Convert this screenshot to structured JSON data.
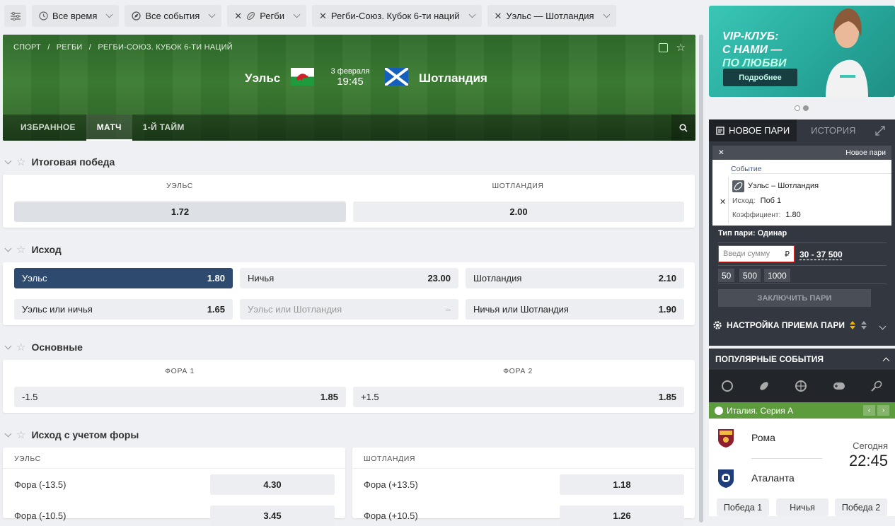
{
  "filters": {
    "time": "Все время",
    "events": "Все события",
    "sport": "Регби",
    "tournament": "Регби-Союз. Кубок 6-ти наций",
    "match": "Уэльс — Шотландия"
  },
  "hero": {
    "breadcrumbs": [
      "СПОРТ",
      "/",
      "РЕГБИ",
      "/",
      "РЕГБИ-СОЮЗ. КУБОК 6-ТИ НАЦИЙ"
    ],
    "home": "Уэльс",
    "away": "Шотландия",
    "date": "3 февраля",
    "time": "19:45",
    "tabs": [
      "ИЗБРАННОЕ",
      "МАТЧ",
      "1-Й ТАЙМ"
    ]
  },
  "markets": {
    "win": {
      "title": "Итоговая победа",
      "col1": "УЭЛЬС",
      "col2": "ШОТЛАНДИЯ",
      "odd1": "1.72",
      "odd2": "2.00"
    },
    "outcome": {
      "title": "Исход",
      "cells": [
        {
          "label": "Уэльс",
          "value": "1.80"
        },
        {
          "label": "Ничья",
          "value": "23.00"
        },
        {
          "label": "Шотландия",
          "value": "2.10"
        },
        {
          "label": "Уэльс или ничья",
          "value": "1.65"
        },
        {
          "label": "Уэльс или Шотландия",
          "value": "–"
        },
        {
          "label": "Ничья или Шотландия",
          "value": "1.90"
        }
      ]
    },
    "main": {
      "title": "Основные",
      "col1": "ФОРА 1",
      "col2": "ФОРА 2",
      "h1": "-1.5",
      "v1": "1.85",
      "h2": "+1.5",
      "v2": "1.85"
    },
    "handicap": {
      "title": "Исход с учетом форы",
      "left_head": "УЭЛЬС",
      "right_head": "ШОТЛАНДИЯ",
      "left": [
        {
          "label": "Фора (-13.5)",
          "value": "4.30"
        },
        {
          "label": "Фора (-10.5)",
          "value": "3.45"
        }
      ],
      "right": [
        {
          "label": "Фора (+13.5)",
          "value": "1.18"
        },
        {
          "label": "Фора (+10.5)",
          "value": "1.26"
        }
      ]
    }
  },
  "promo": {
    "line1": "VIP-КЛУБ:",
    "line2": "С НАМИ —",
    "line3": "ПО ЛЮБВИ",
    "button": "Подробнее"
  },
  "betslip": {
    "tab_new": "НОВОЕ ПАРИ",
    "tab_history": "ИСТОРИЯ",
    "head_right": "Новое пари",
    "event_label": "Событие",
    "event": "Уэльс – Шотландия",
    "outcome_label": "Исход:",
    "outcome": "Поб 1",
    "coef_label": "Коэффициент:",
    "coef": "1.80",
    "type": "Тип пари: Одинар",
    "placeholder": "Введи сумму",
    "currency": "₽",
    "range": "30 - 37 500",
    "quick": [
      "50",
      "500",
      "1000"
    ],
    "place": "ЗАКЛЮЧИТЬ ПАРИ",
    "settings": "НАСТРОЙКА ПРИЕМА ПАРИ"
  },
  "popular": {
    "title": "ПОПУЛЯРНЫЕ СОБЫТИЯ",
    "league": "Италия. Серия А",
    "home": "Рома",
    "away": "Аталанта",
    "day": "Сегодня",
    "time": "22:45",
    "b1": "Победа 1",
    "bx": "Ничья",
    "b2": "Победа 2"
  }
}
